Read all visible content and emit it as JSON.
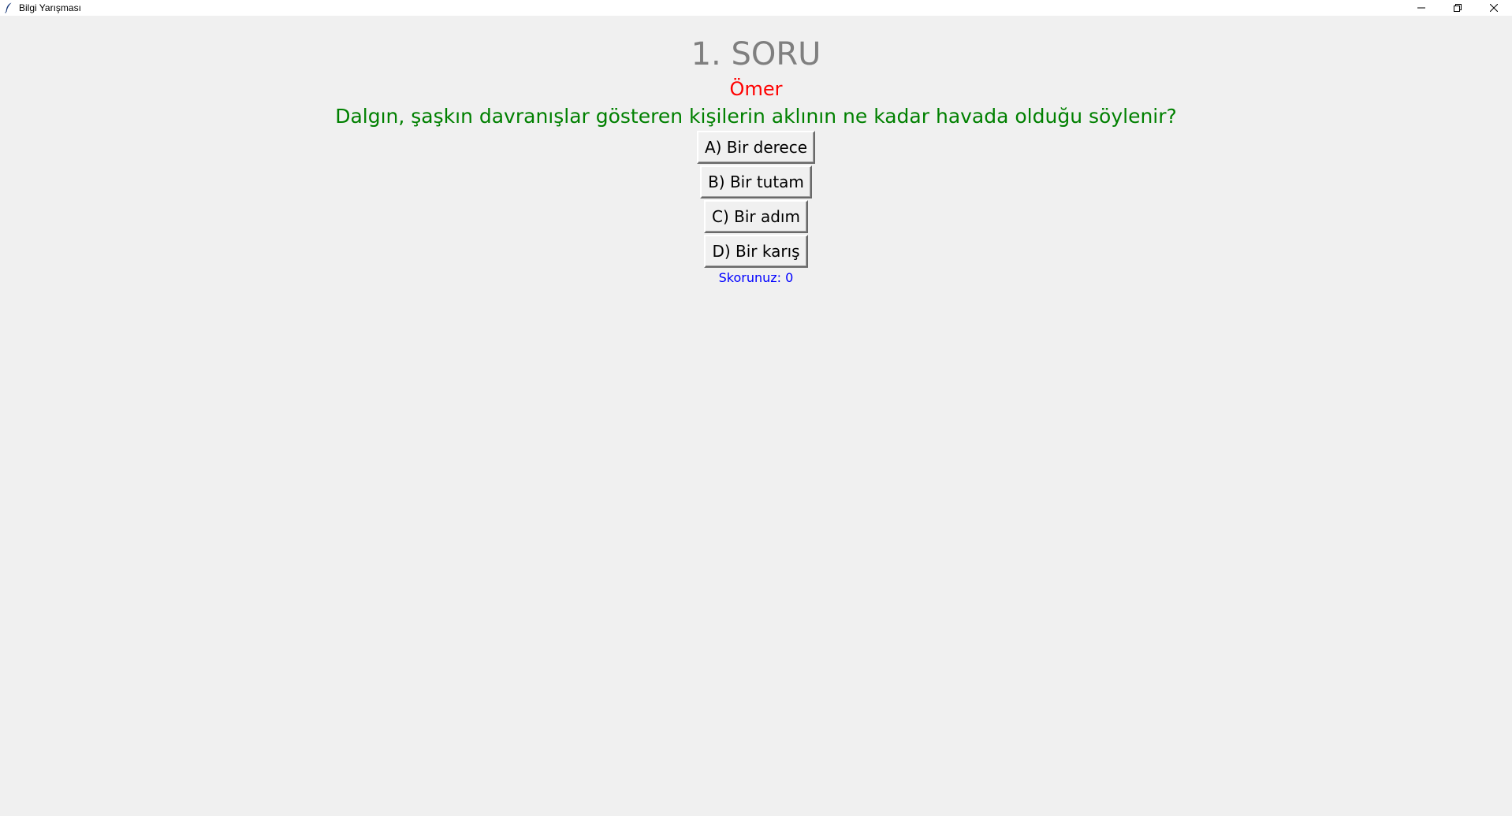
{
  "window": {
    "title": "Bilgi Yarışması",
    "icon": "feather-icon",
    "controls": [
      "minimize-icon",
      "restore-icon",
      "close-icon"
    ]
  },
  "quiz": {
    "question_number": "1. SORU",
    "player_name": "Ömer",
    "question": "Dalgın, şaşkın davranışlar gösteren kişilerin aklının ne kadar havada olduğu söylenir?",
    "options": [
      "A) Bir derece",
      "B) Bir tutam",
      "C) Bir adım",
      "D) Bir karış"
    ],
    "score_text": "Skorunuz: 0"
  },
  "colors": {
    "background": "#f0f0f0",
    "question_number": "#7f7f7f",
    "player_name": "#ff0000",
    "question": "#008000",
    "score": "#0000ff"
  }
}
